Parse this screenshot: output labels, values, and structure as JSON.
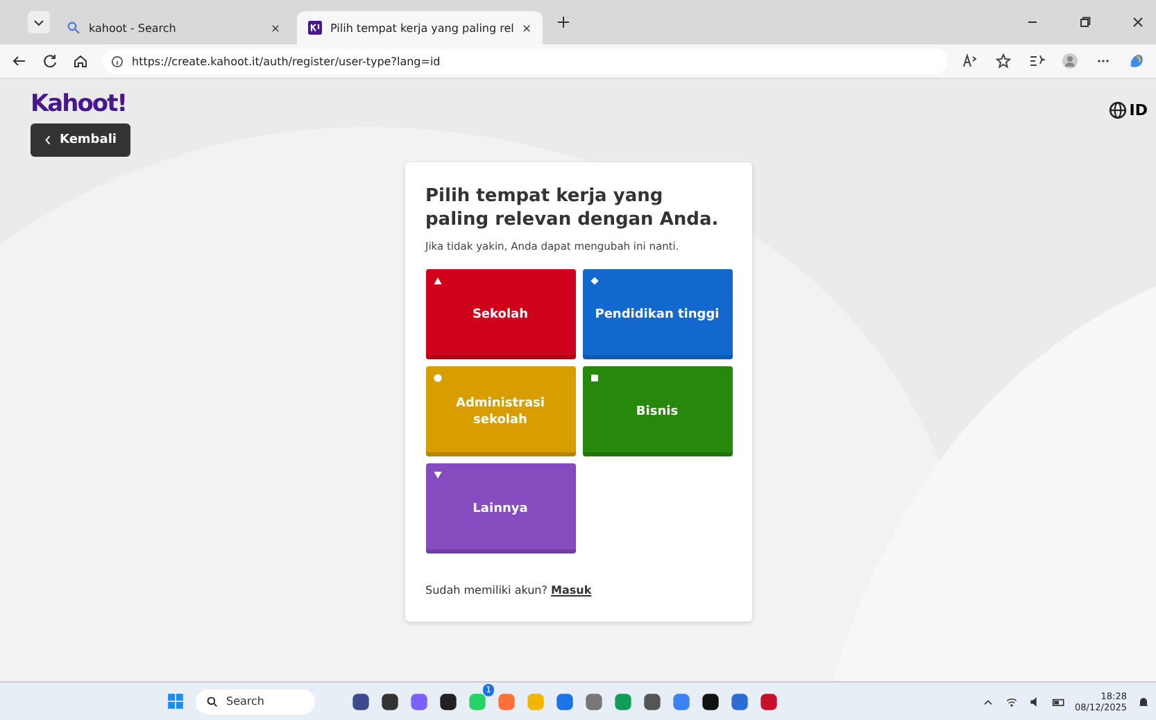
{
  "browser": {
    "tabs": [
      {
        "title": "kahoot - Search",
        "selected": false,
        "kind": "search"
      },
      {
        "title": "Pilih tempat kerja yang paling rel",
        "selected": true,
        "kind": "kahoot"
      }
    ],
    "url": "https://create.kahoot.it/auth/register/user-type?lang=id"
  },
  "header": {
    "logo": "Kahoot!",
    "back_button": "Kembali",
    "language": "ID"
  },
  "card": {
    "title": "Pilih tempat kerja yang paling relevan dengan Anda.",
    "subtitle": "Jika tidak yakin, Anda dapat mengubah ini nanti.",
    "options": [
      {
        "label": "Sekolah",
        "kind": "triangle",
        "color": "#d0021b"
      },
      {
        "label": "Pendidikan tinggi",
        "kind": "diamond",
        "color": "#1368ce"
      },
      {
        "label": "Administrasi sekolah",
        "kind": "circle",
        "color": "#d89e00"
      },
      {
        "label": "Bisnis",
        "kind": "square",
        "color": "#26890c"
      },
      {
        "label": "Lainnya",
        "kind": "triangle-down",
        "color": "#864cbf"
      }
    ],
    "footer_text": "Sudah memiliki akun?",
    "login_link": "Masuk"
  },
  "taskbar": {
    "search_placeholder": "Search",
    "badge": "1",
    "time": "18:28",
    "date": "08/12/2025"
  }
}
